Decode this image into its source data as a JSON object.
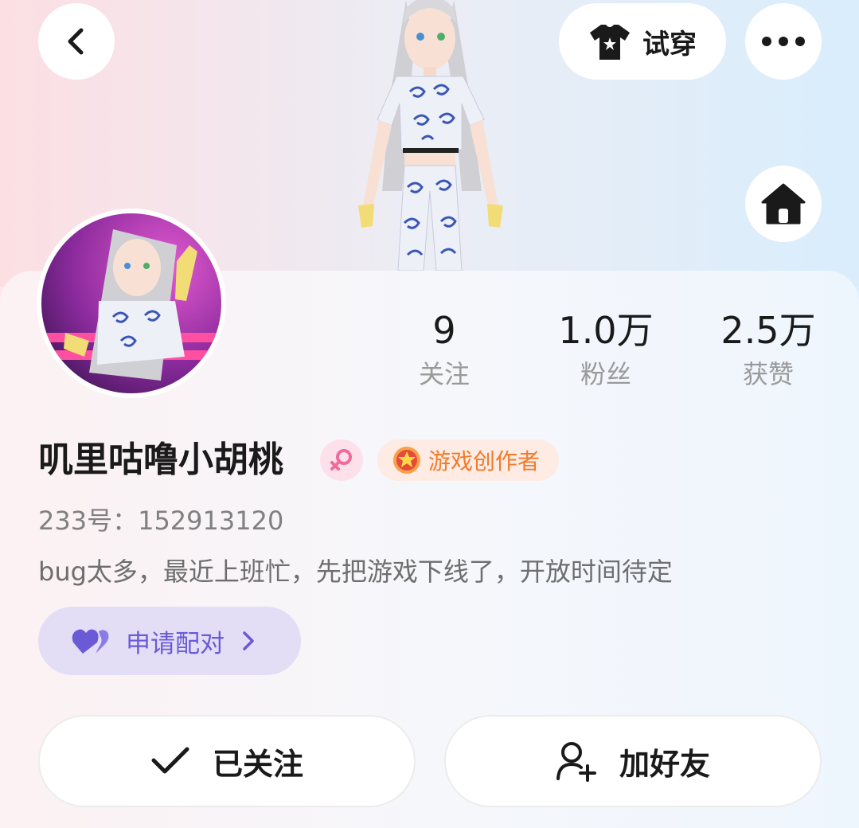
{
  "header": {
    "back_icon": "chevron-left-icon",
    "tryon_label": "试穿",
    "tryon_icon": "tshirt-icon",
    "more_icon": "more-horizontal-icon",
    "home_icon": "home-icon"
  },
  "profile": {
    "name": "叽里咕噜小胡桃",
    "gender_icon": "female-icon",
    "creator_badge": "游戏创作者",
    "uid": "233号：152913120",
    "bio": "bug太多，最近上班忙，先把游戏下线了，开放时间待定"
  },
  "stats": [
    {
      "value": "9",
      "label": "关注"
    },
    {
      "value": "1.0万",
      "label": "粉丝"
    },
    {
      "value": "2.5万",
      "label": "获赞"
    }
  ],
  "pair": {
    "label": "申请配对",
    "icon": "heart-pair-icon",
    "arrow": "chevron-right-icon"
  },
  "actions": {
    "follow_label": "已关注",
    "follow_icon": "check-icon",
    "friend_label": "加好友",
    "friend_icon": "add-user-icon"
  },
  "colors": {
    "accent_purple": "#6a5ad6",
    "creator_orange": "#f07b2b",
    "gender_pink": "#f06b9a"
  }
}
